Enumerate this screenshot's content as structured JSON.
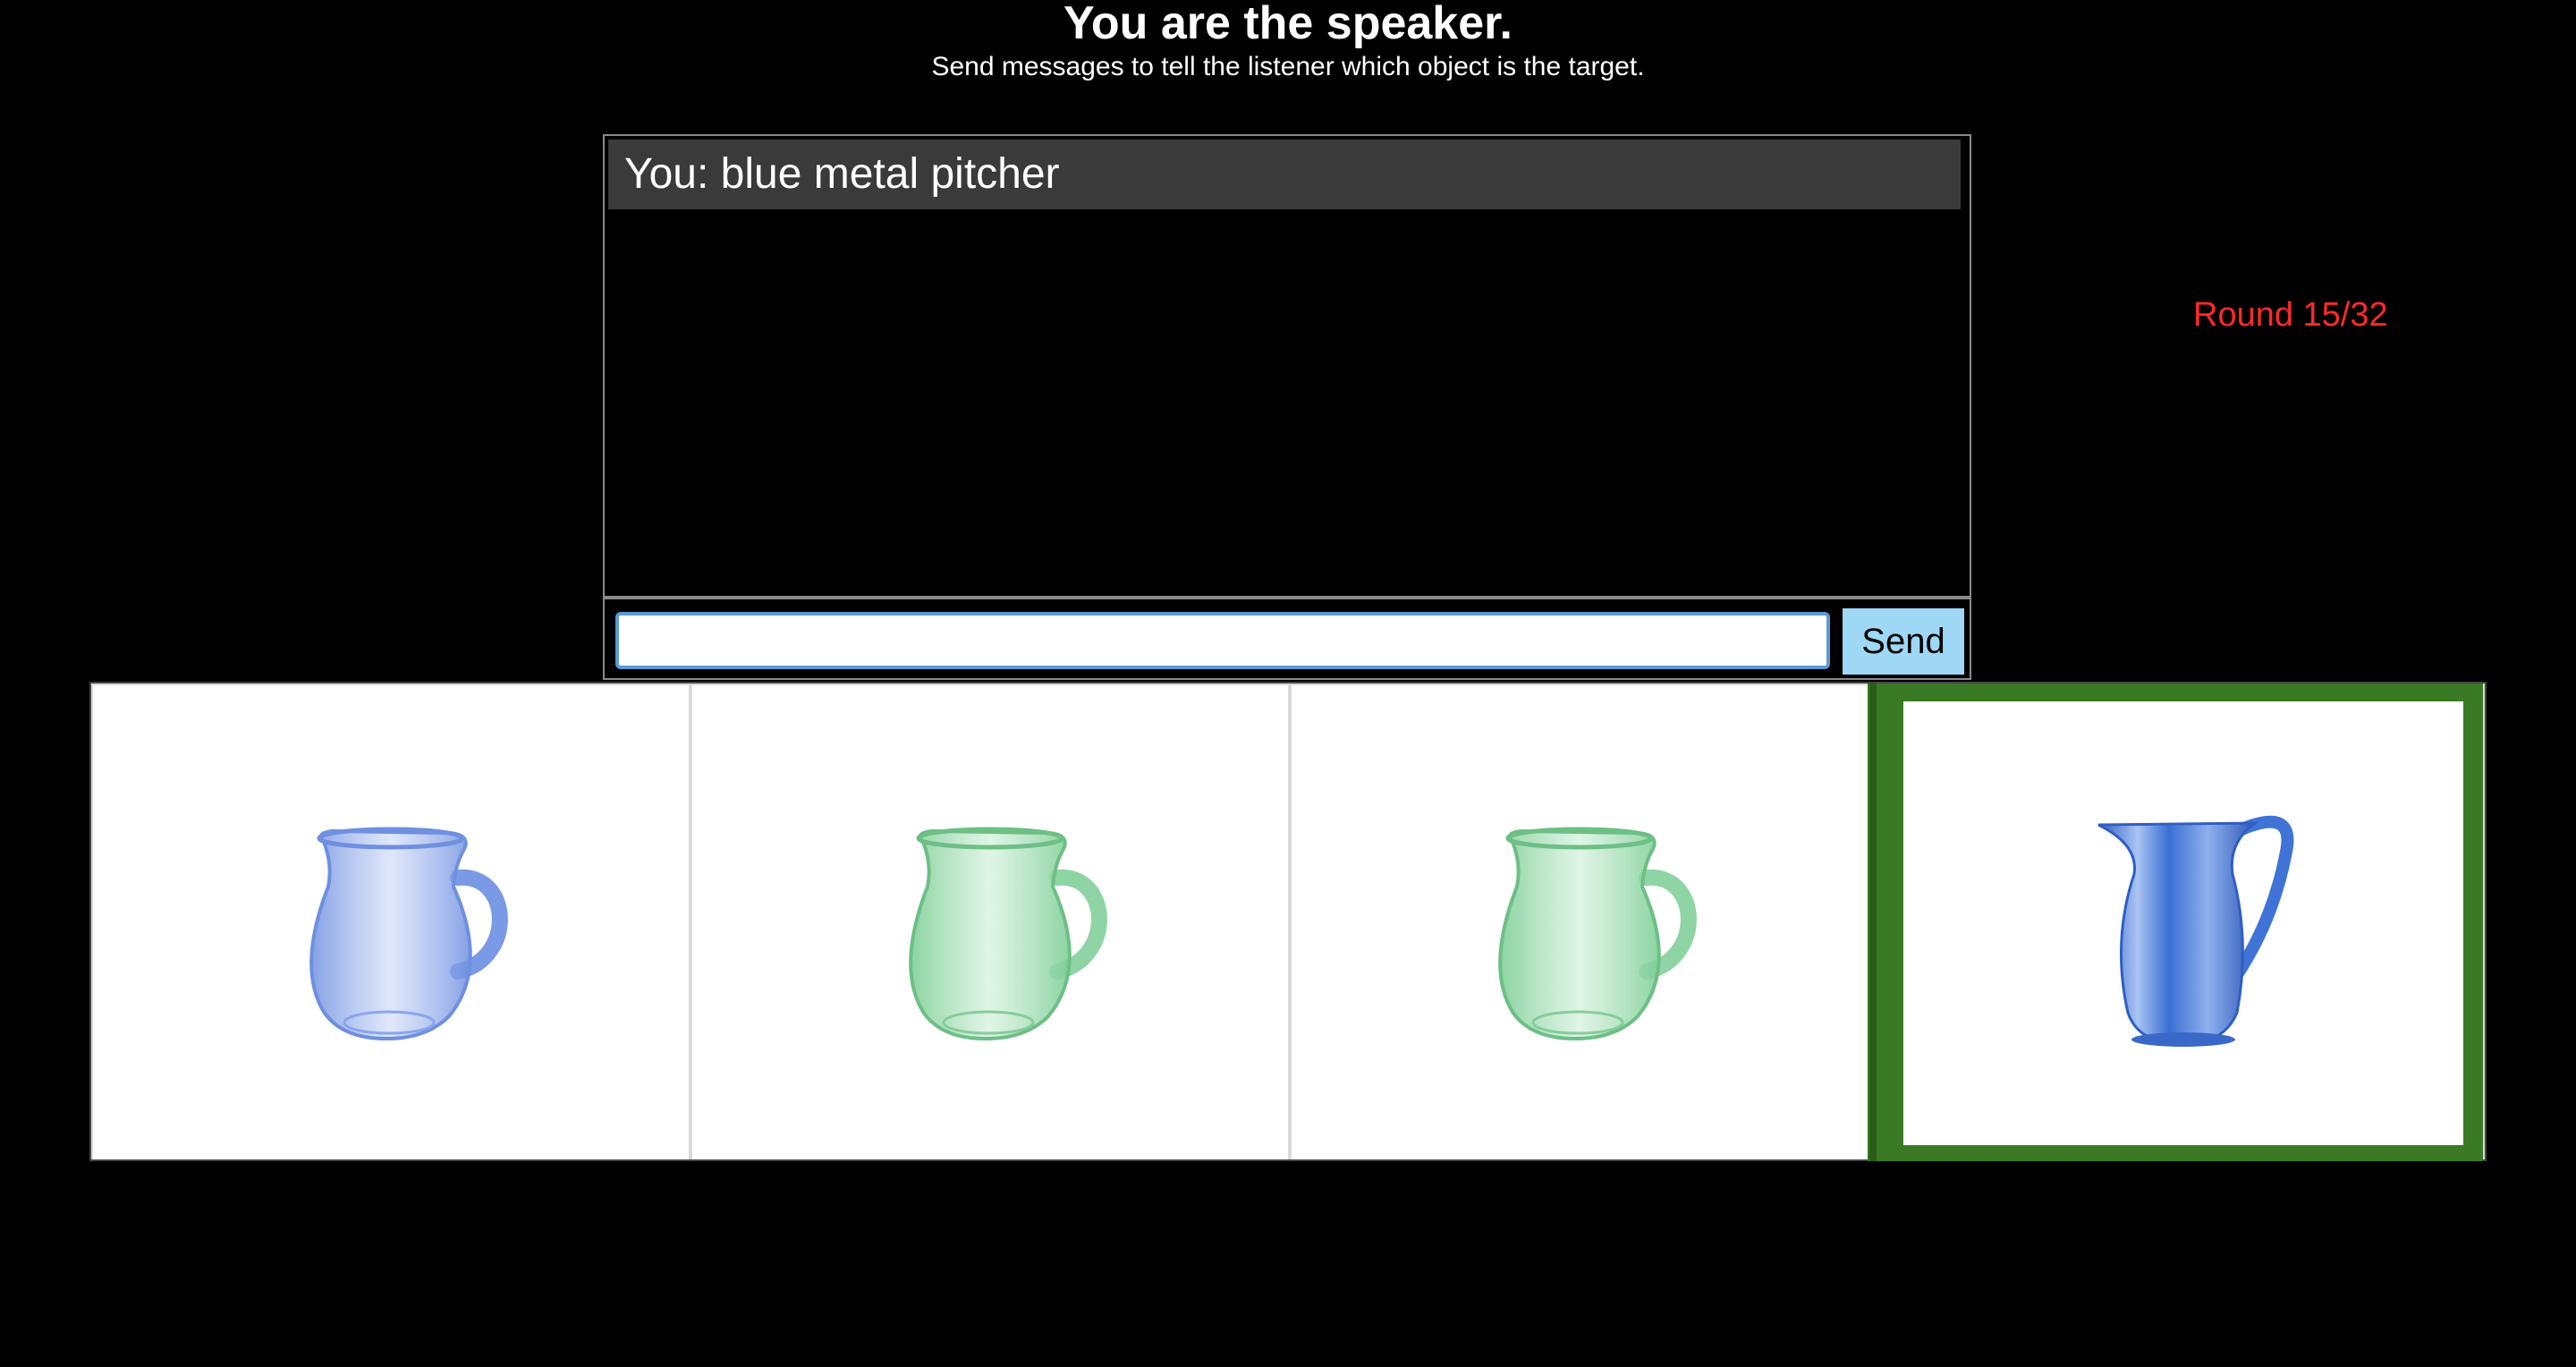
{
  "header": {
    "title": "You are the speaker.",
    "subtitle": "Send messages to tell the listener which object is the target."
  },
  "status": {
    "round": "Round 15/32"
  },
  "chat": {
    "messages": [
      {
        "text": "You: blue metal pitcher"
      }
    ]
  },
  "composer": {
    "value": "",
    "send_label": "Send"
  },
  "objects": [
    {
      "icon": "blue-glass-pitcher-icon",
      "color": "#7a9ae6",
      "is_target": false
    },
    {
      "icon": "green-glass-pitcher-icon",
      "color": "#8ed4a4",
      "is_target": false
    },
    {
      "icon": "green-glass-pitcher-icon",
      "color": "#8ed4a4",
      "is_target": false
    },
    {
      "icon": "blue-metal-pitcher-icon",
      "color": "#3f74d6",
      "is_target": true
    }
  ],
  "colors": {
    "round_text": "#ff2a2a",
    "target_frame": "#3b7a25",
    "send_button": "#9ed8f5"
  }
}
